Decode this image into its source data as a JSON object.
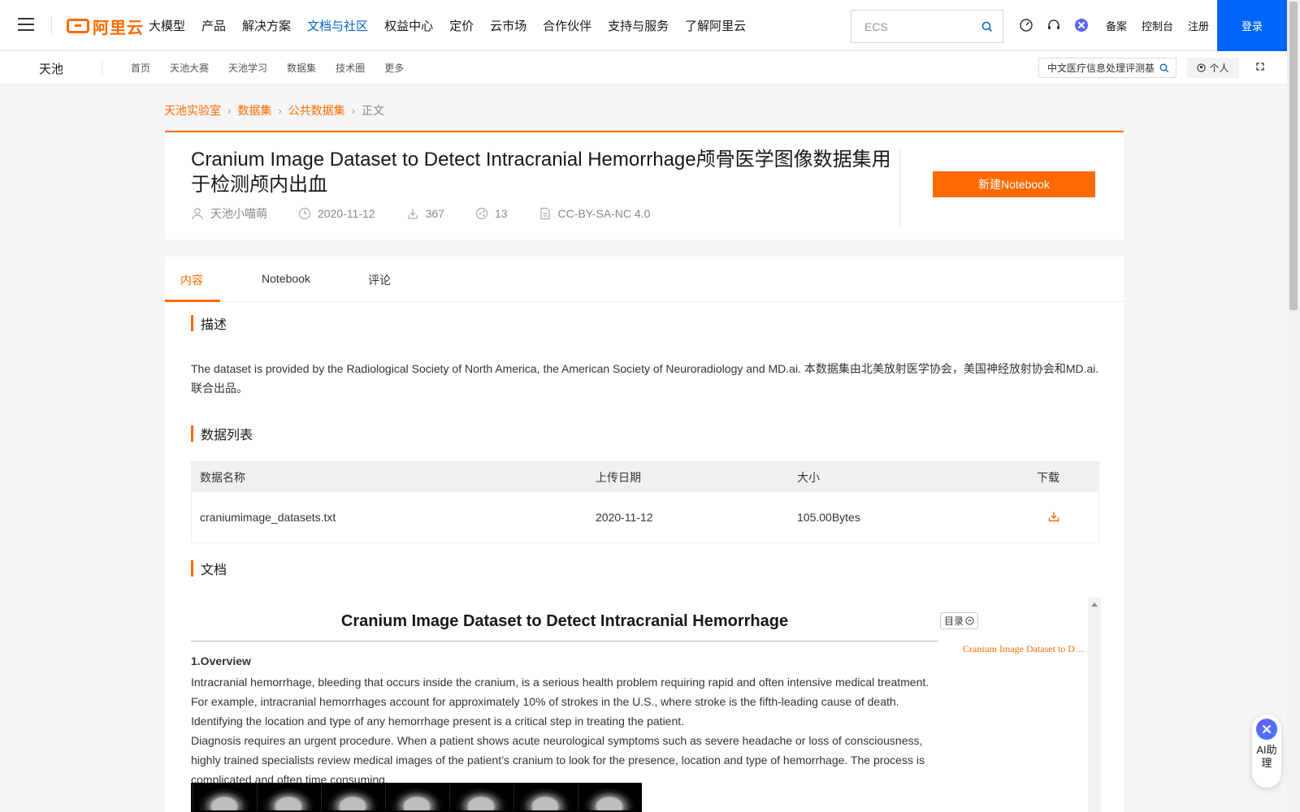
{
  "topnav": {
    "logo_text": "阿里云",
    "links": [
      "大模型",
      "产品",
      "解决方案",
      "文档与社区",
      "权益中心",
      "定价",
      "云市场",
      "合作伙伴",
      "支持与服务",
      "了解阿里云"
    ],
    "active_link": "文档与社区",
    "search_placeholder": "ECS",
    "right_links": [
      "备案",
      "控制台",
      "注册"
    ],
    "login_label": "登录"
  },
  "subnav": {
    "brand": "天池",
    "links": [
      "首页",
      "天池大赛",
      "天池学习",
      "数据集",
      "技术圈",
      "更多"
    ],
    "search_value": "中文医疗信息处理评测基",
    "personal_label": "个人"
  },
  "breadcrumb": {
    "items": [
      "天池实验室",
      "数据集",
      "公共数据集"
    ],
    "current": "正文"
  },
  "dataset": {
    "title": "Cranium Image Dataset to Detect Intracranial Hemorrhage颅骨医学图像数据集用于检测颅内出血",
    "author": "天池小喵萌",
    "date": "2020-11-12",
    "downloads": "367",
    "stars": "13",
    "license": "CC-BY-SA-NC 4.0",
    "new_notebook_label": "新建Notebook"
  },
  "tabs": [
    "内容",
    "Notebook",
    "评论"
  ],
  "active_tab": "内容",
  "sections": {
    "description_title": "描述",
    "description_text": "  The dataset is provided by the Radiological Society of North America, the American Society of Neuroradiology and MD.ai. 本数据集由北美放射医学协会，美国神经放射协会和MD.ai.联合出品。",
    "datalist_title": "数据列表",
    "doc_title": "文档"
  },
  "data_table": {
    "headers": [
      "数据名称",
      "上传日期",
      "大小",
      "下载"
    ],
    "rows": [
      {
        "name": "craniumimage_datasets.txt",
        "date": "2020-11-12",
        "size": "105.00Bytes"
      }
    ]
  },
  "document": {
    "heading": "Cranium Image Dataset to Detect Intracranial Hemorrhage",
    "overview_heading": "1.Overview",
    "paragraph1": "Intracranial hemorrhage, bleeding that occurs inside the cranium, is a serious health problem requiring rapid and often intensive medical treatment. For example, intracranial hemorrhages account for approximately 10% of strokes in the U.S., where stroke is the fifth-leading cause of death. Identifying the location and type of any hemorrhage present is a critical step in treating the patient.",
    "paragraph2": "Diagnosis requires an urgent procedure. When a patient shows acute neurological symptoms such as severe headache or loss of consciousness, highly trained specialists review medical images of the patient’s cranium to look for the presence, location and type of hemorrhage. The process is complicated and often time consuming.",
    "toc_label": "目录",
    "toc_items": [
      "Cranium Image Dataset to Detect Intracranial Hemorrhage"
    ]
  },
  "assistant": {
    "label": "AI助理"
  },
  "colors": {
    "accent": "#ff6a00",
    "nav_active": "#0064c8",
    "login_bg": "#0064fa"
  }
}
